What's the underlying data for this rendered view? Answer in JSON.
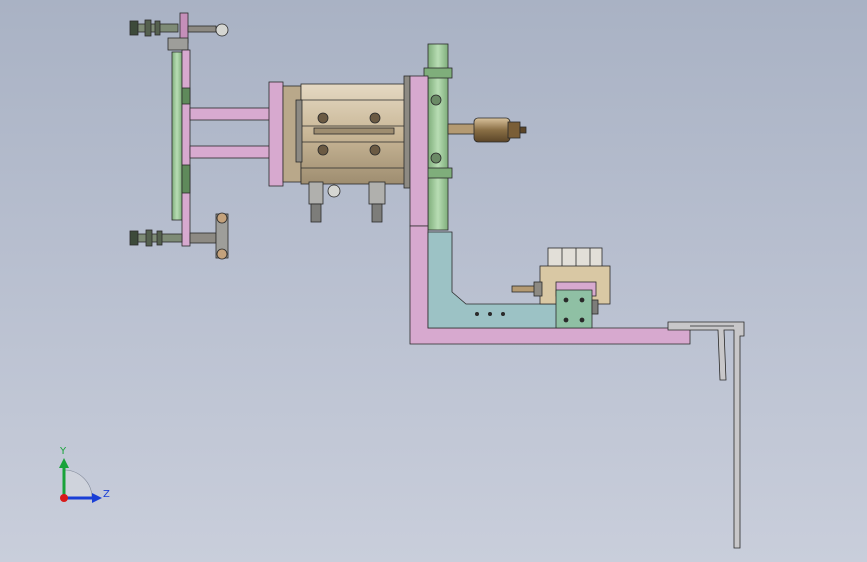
{
  "triad": {
    "y_label": "Y",
    "z_label": "Z",
    "y_color": "#19a33a",
    "z_color": "#1a3fd6",
    "origin_color": "#d81a1a"
  },
  "colors": {
    "background_top": "#a9b2c4",
    "background_bottom": "#c9cedb",
    "plate_pink": "#d7a9cf",
    "plate_green": "#9fc79a",
    "bracket_teal": "#9cc2c5",
    "steel": "#c8b79c",
    "dark_steel": "#8d8a83",
    "bracket_gray": "#c8c7c9",
    "outline": "#2a2a2a"
  }
}
